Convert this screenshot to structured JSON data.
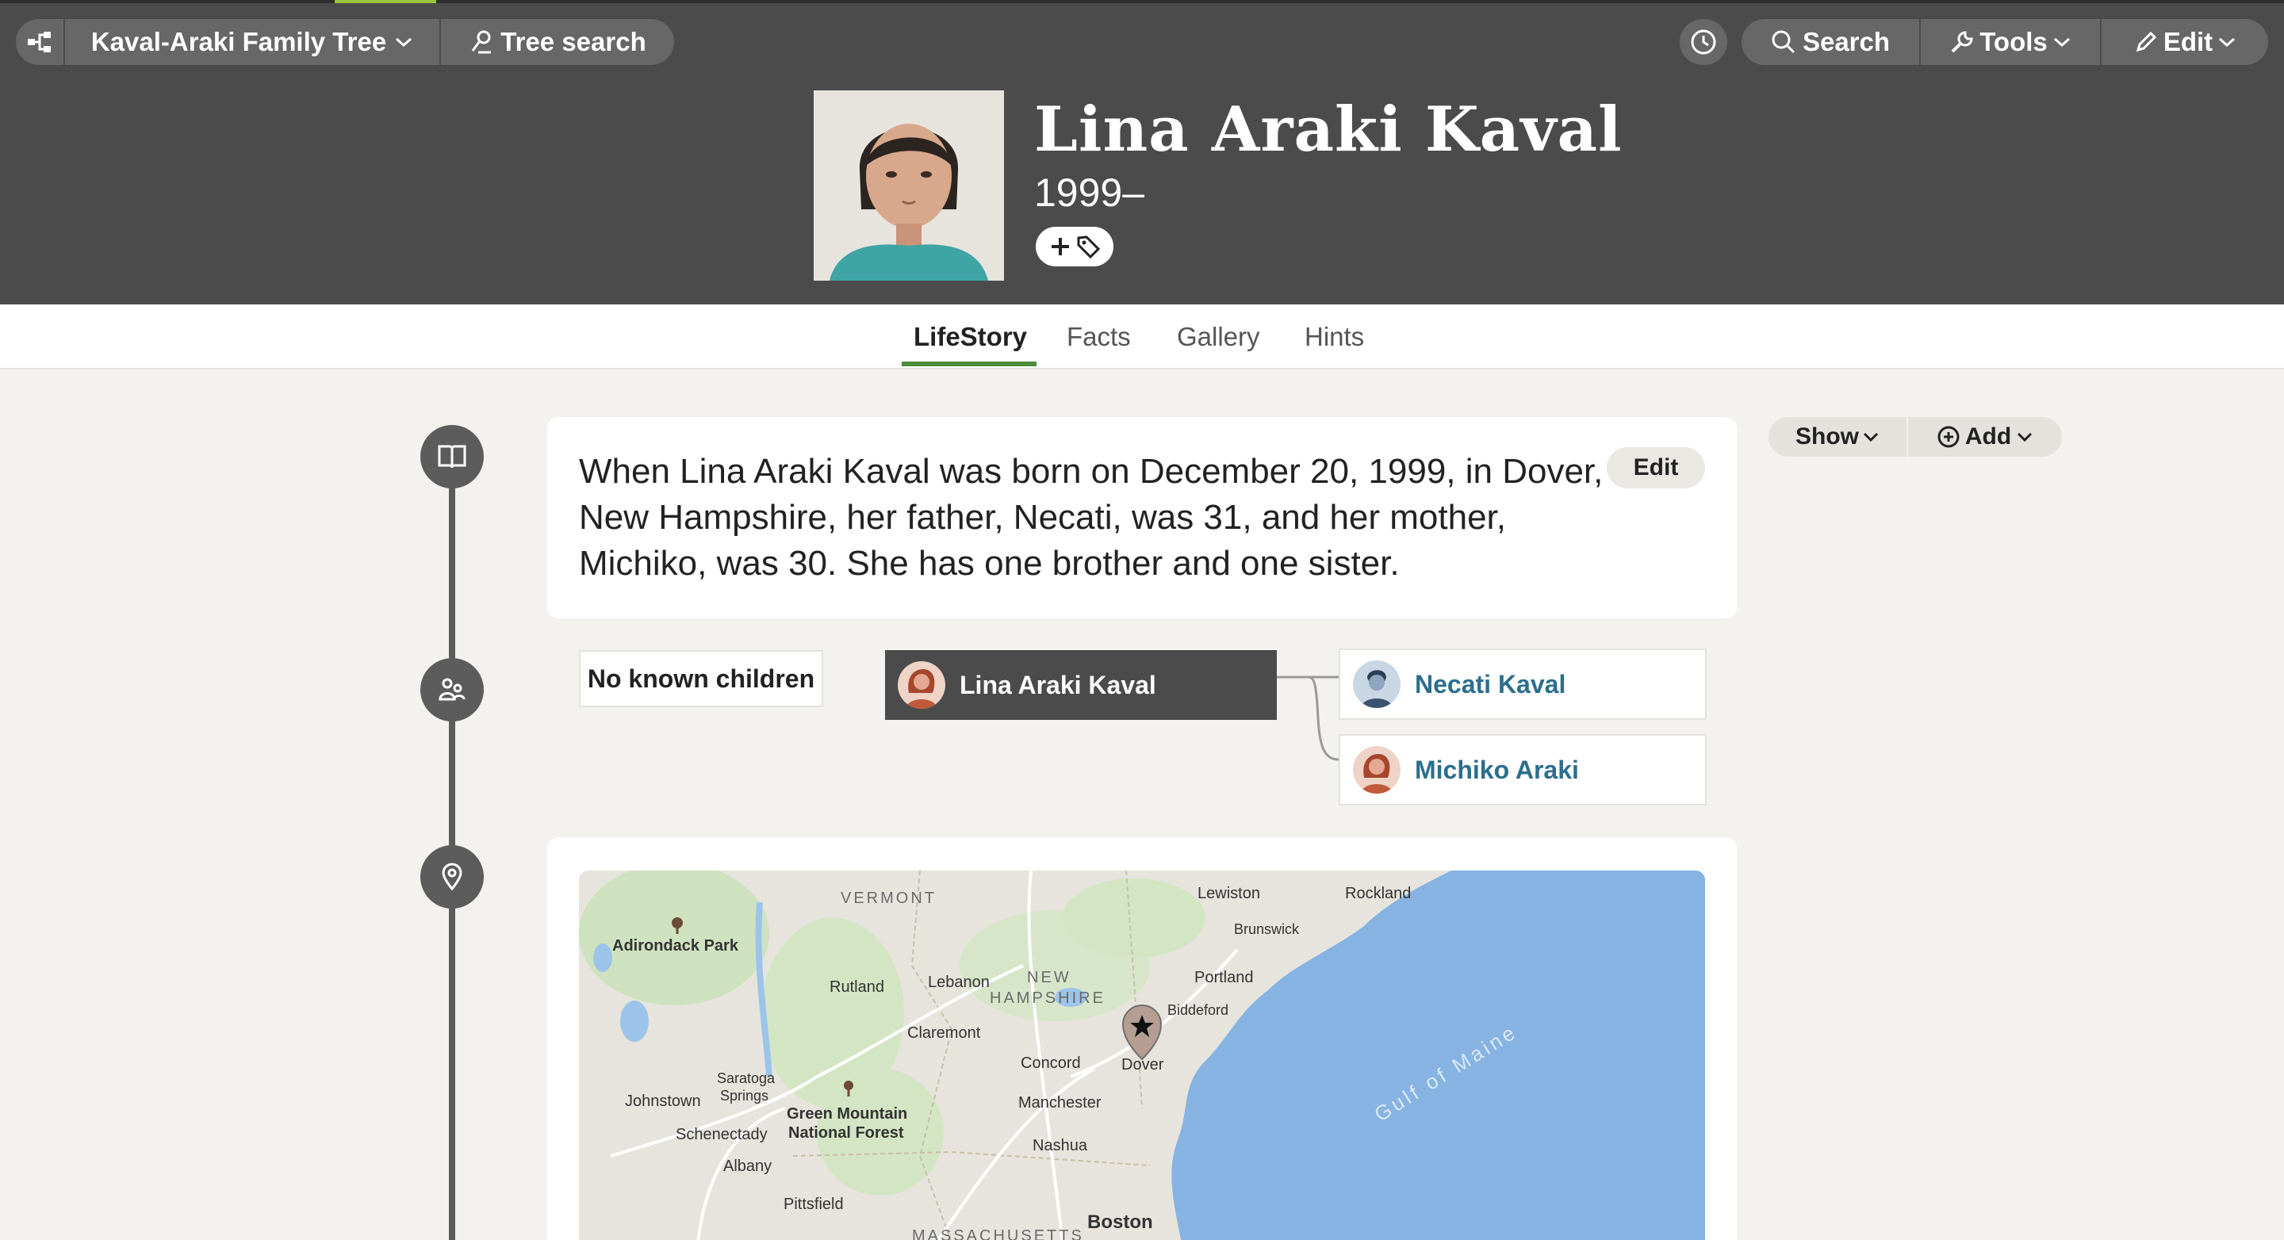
{
  "header": {
    "tree_name": "Kaval-Araki Family Tree",
    "tree_search_label": "Tree search",
    "search_label": "Search",
    "tools_label": "Tools",
    "edit_label": "Edit",
    "person_name": "Lina Araki Kaval",
    "person_dates": "1999–"
  },
  "tabs": [
    {
      "label": "LifeStory",
      "active": true
    },
    {
      "label": "Facts"
    },
    {
      "label": "Gallery"
    },
    {
      "label": "Hints"
    }
  ],
  "story": {
    "text": "When Lina Araki Kaval was born on December 20, 1999, in Dover, New Hampshire, her father, Necati, was 31, and her mother, Michiko, was 30. She has one brother and one sister.",
    "edit_label": "Edit"
  },
  "sidebar": {
    "show_label": "Show",
    "add_label": "Add"
  },
  "family": {
    "no_children_label": "No known children",
    "self_name": "Lina Araki Kaval",
    "father_name": "Necati Kaval",
    "mother_name": "Michiko Araki"
  },
  "map": {
    "labels": {
      "vermont": "VERMONT",
      "new": "NEW",
      "hampshire": "HAMPSHIRE",
      "massachusetts": "MASSACHUSETTS",
      "adirondack": "Adirondack Park",
      "rutland": "Rutland",
      "lebanon": "Lebanon",
      "claremont": "Claremont",
      "concord": "Concord",
      "dover": "Dover",
      "manchester": "Manchester",
      "nashua": "Nashua",
      "boston": "Boston",
      "lewiston": "Lewiston",
      "rockland": "Rockland",
      "brunswick": "Brunswick",
      "portland": "Portland",
      "biddeford": "Biddeford",
      "johnstown": "Johnstown",
      "saratoga1": "Saratoga",
      "saratoga2": "Springs",
      "schenectady": "Schenectady",
      "albany": "Albany",
      "pittsfield": "Pittsfield",
      "green1": "Green Mountain",
      "green2": "National Forest",
      "gulf": "Gulf of Maine"
    }
  },
  "colors": {
    "header_bg": "#4b4b4b",
    "accent_green": "#4c8d3a",
    "link_blue": "#2c6e8d",
    "water": "#86b3e2"
  }
}
